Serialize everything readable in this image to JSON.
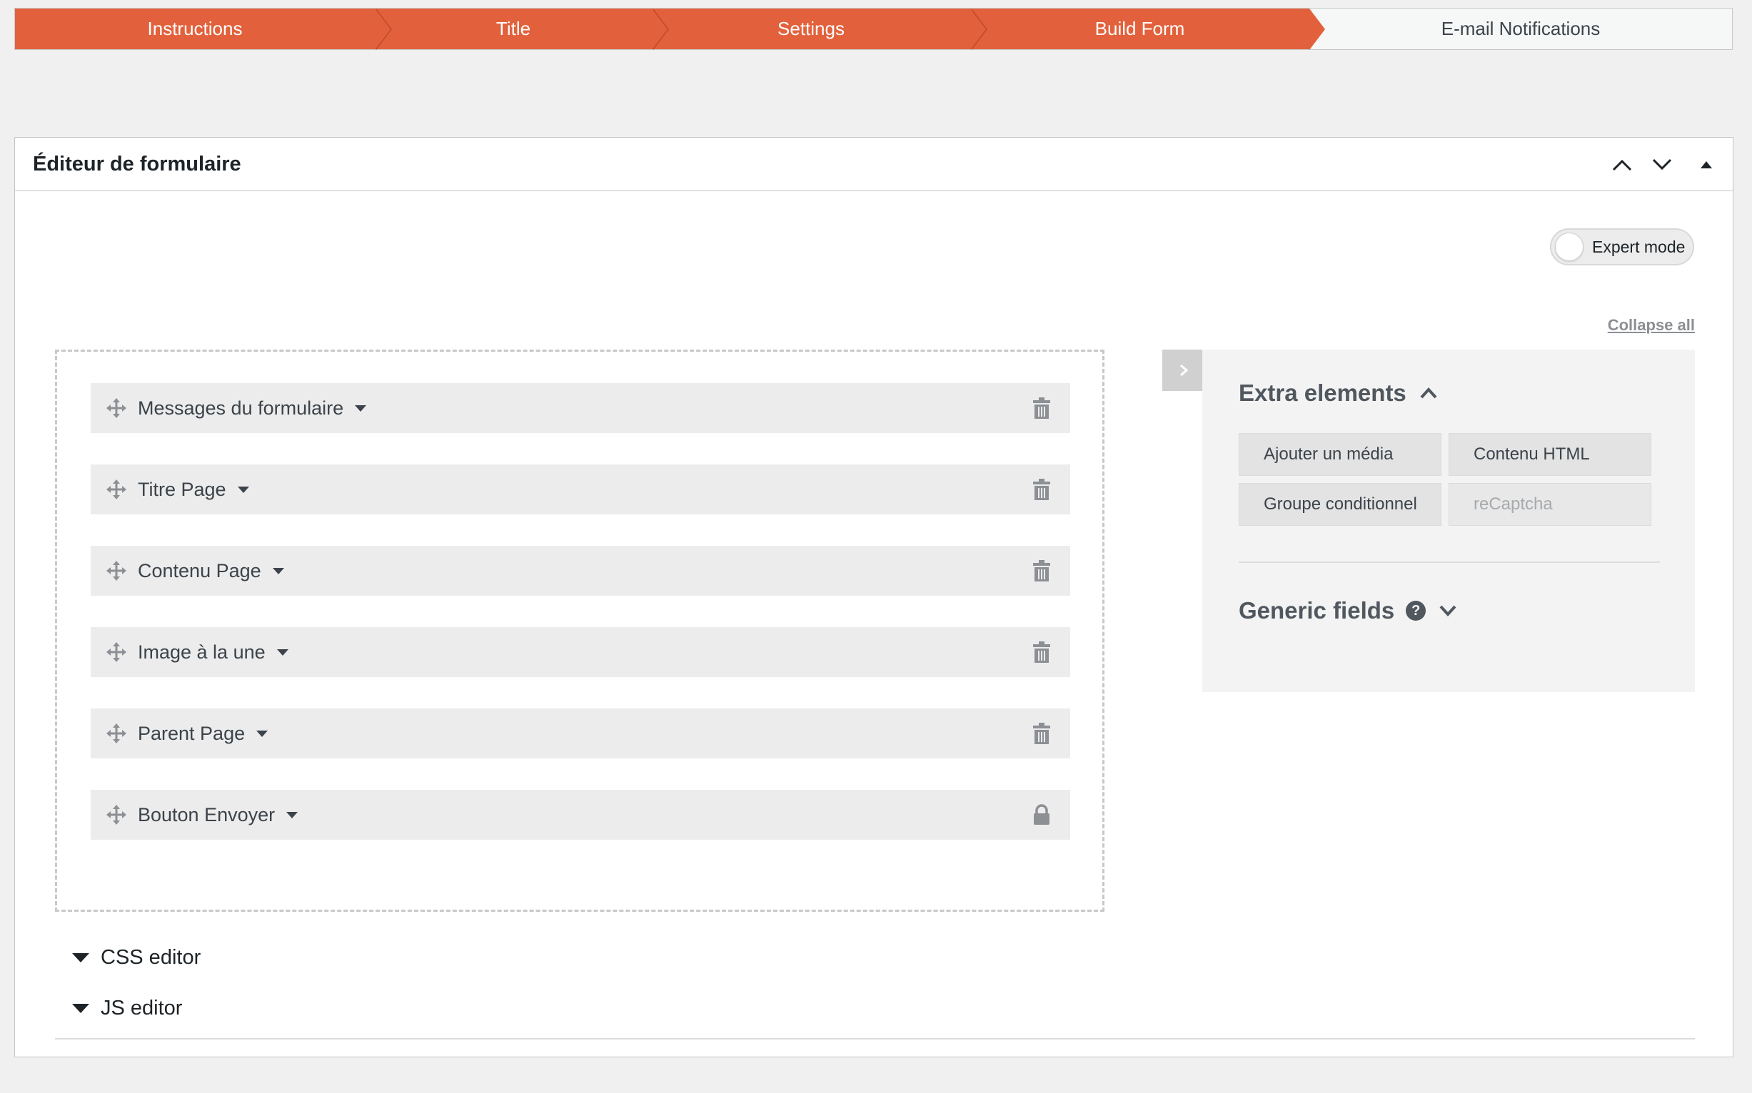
{
  "steps": [
    {
      "label": "Instructions",
      "active": true
    },
    {
      "label": "Title",
      "active": true
    },
    {
      "label": "Settings",
      "active": true
    },
    {
      "label": "Build Form",
      "active": true
    },
    {
      "label": "E-mail Notifications",
      "active": false
    }
  ],
  "colors": {
    "accent": "#e2613c",
    "panel": "#ececec"
  },
  "postbox": {
    "title": "Éditeur de formulaire",
    "expert_mode": {
      "label": "Expert mode",
      "enabled": false
    },
    "collapse_all": "Collapse all"
  },
  "fields": [
    {
      "label": "Messages du formulaire",
      "action": "trash-icon"
    },
    {
      "label": "Titre Page",
      "action": "trash-icon"
    },
    {
      "label": "Contenu Page",
      "action": "trash-icon"
    },
    {
      "label": "Image à la une",
      "action": "trash-icon"
    },
    {
      "label": "Parent Page",
      "action": "trash-icon"
    },
    {
      "label": "Bouton Envoyer",
      "action": "lock-icon"
    }
  ],
  "sidebar": {
    "extra_title": "Extra elements",
    "extra_buttons": [
      {
        "label": "Ajouter un média",
        "disabled": false
      },
      {
        "label": "Contenu HTML",
        "disabled": false
      },
      {
        "label": "Groupe conditionnel",
        "disabled": false
      },
      {
        "label": "reCaptcha",
        "disabled": true
      }
    ],
    "generic_title": "Generic fields",
    "help_glyph": "?"
  },
  "editors": {
    "css": "CSS editor",
    "js": "JS editor"
  }
}
